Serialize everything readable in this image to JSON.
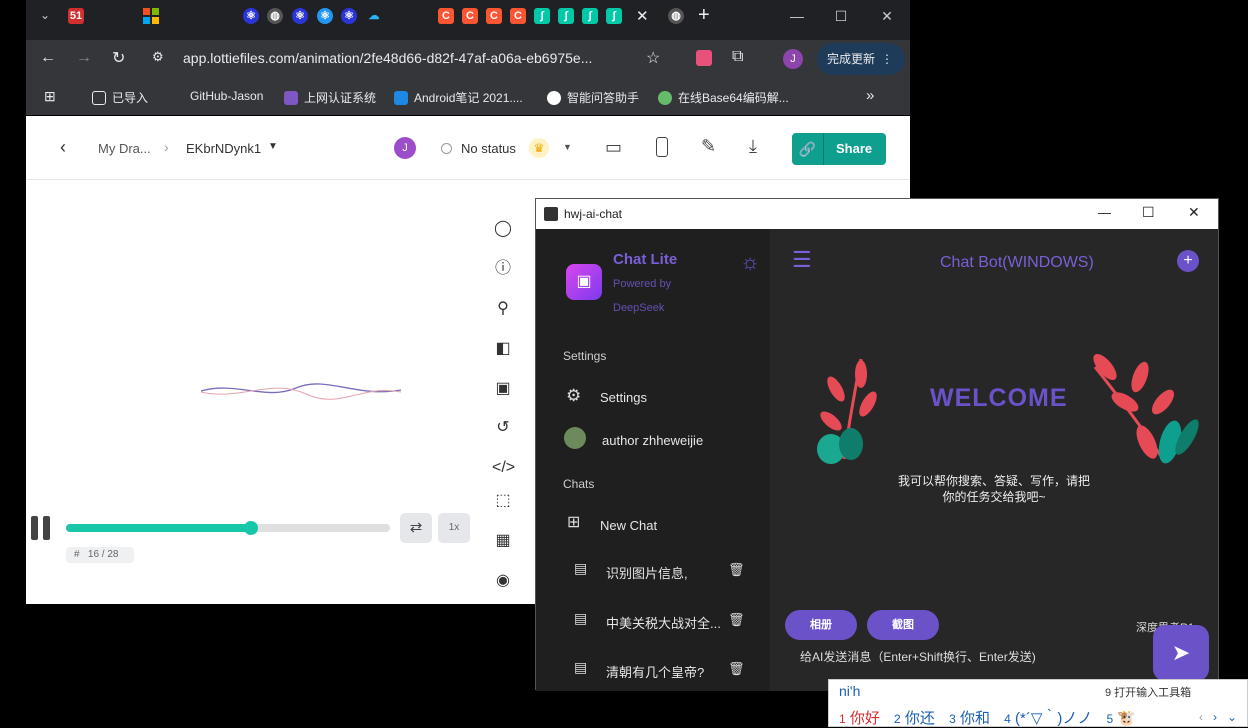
{
  "browser": {
    "url": "app.lottiefiles.com/animation/2fe48d66-d82f-47af-a06a-eb6975e...",
    "update_button": "完成更新",
    "tab_badge_51": "51",
    "profile_letter": "J",
    "bookmarks": [
      {
        "label": "已导入"
      },
      {
        "label": "GitHub-Jason"
      },
      {
        "label": "上网认证系统"
      },
      {
        "label": "Android笔记 2021...."
      },
      {
        "label": "智能问答助手"
      },
      {
        "label": "在线Base64编码解..."
      }
    ]
  },
  "lottie": {
    "breadcrumb_folder": "My Dra...",
    "animation_name": "EKbrNDynk1",
    "avatar_letter": "J",
    "status": "No status",
    "share_label": "Share",
    "speed": "1x",
    "frame_hash": "#",
    "frame_counter": "16 / 28",
    "progress": 0.57
  },
  "chat": {
    "window_title": "hwj-ai-chat",
    "app_name": "Chat Lite",
    "powered_by": "Powered by",
    "provider": "DeepSeek",
    "settings_header": "Settings",
    "settings_item": "Settings",
    "author_item": "author zhheweijie",
    "chats_header": "Chats",
    "new_chat": "New Chat",
    "history": [
      {
        "title": "识别图片信息,"
      },
      {
        "title": "中美关税大战对全..."
      },
      {
        "title": "清朝有几个皇帝?"
      }
    ],
    "bot_title": "Chat Bot(WINDOWS)",
    "welcome": "WELCOME",
    "intro_line1": "我可以帮你搜索、答疑、写作，请把",
    "intro_line2": "你的任务交给我吧~",
    "album_button": "相册",
    "screenshot_button": "截图",
    "deep_think": "深度思考R1",
    "input_placeholder": "给AI发送消息（Enter+Shift换行、Enter发送)"
  },
  "ime": {
    "composition": "ni'h",
    "toolbox": "9 打开输入工具箱",
    "candidates": [
      {
        "num": "1",
        "text": "你好"
      },
      {
        "num": "2",
        "text": "你还"
      },
      {
        "num": "3",
        "text": "你和"
      },
      {
        "num": "4",
        "text": "(*´▽｀)ノノ"
      },
      {
        "num": "5",
        "text": "🐮"
      }
    ]
  },
  "colors": {
    "accent": "#6b52c9",
    "teal": "#0f9f8f",
    "brand_text": "#7b5fd6"
  }
}
